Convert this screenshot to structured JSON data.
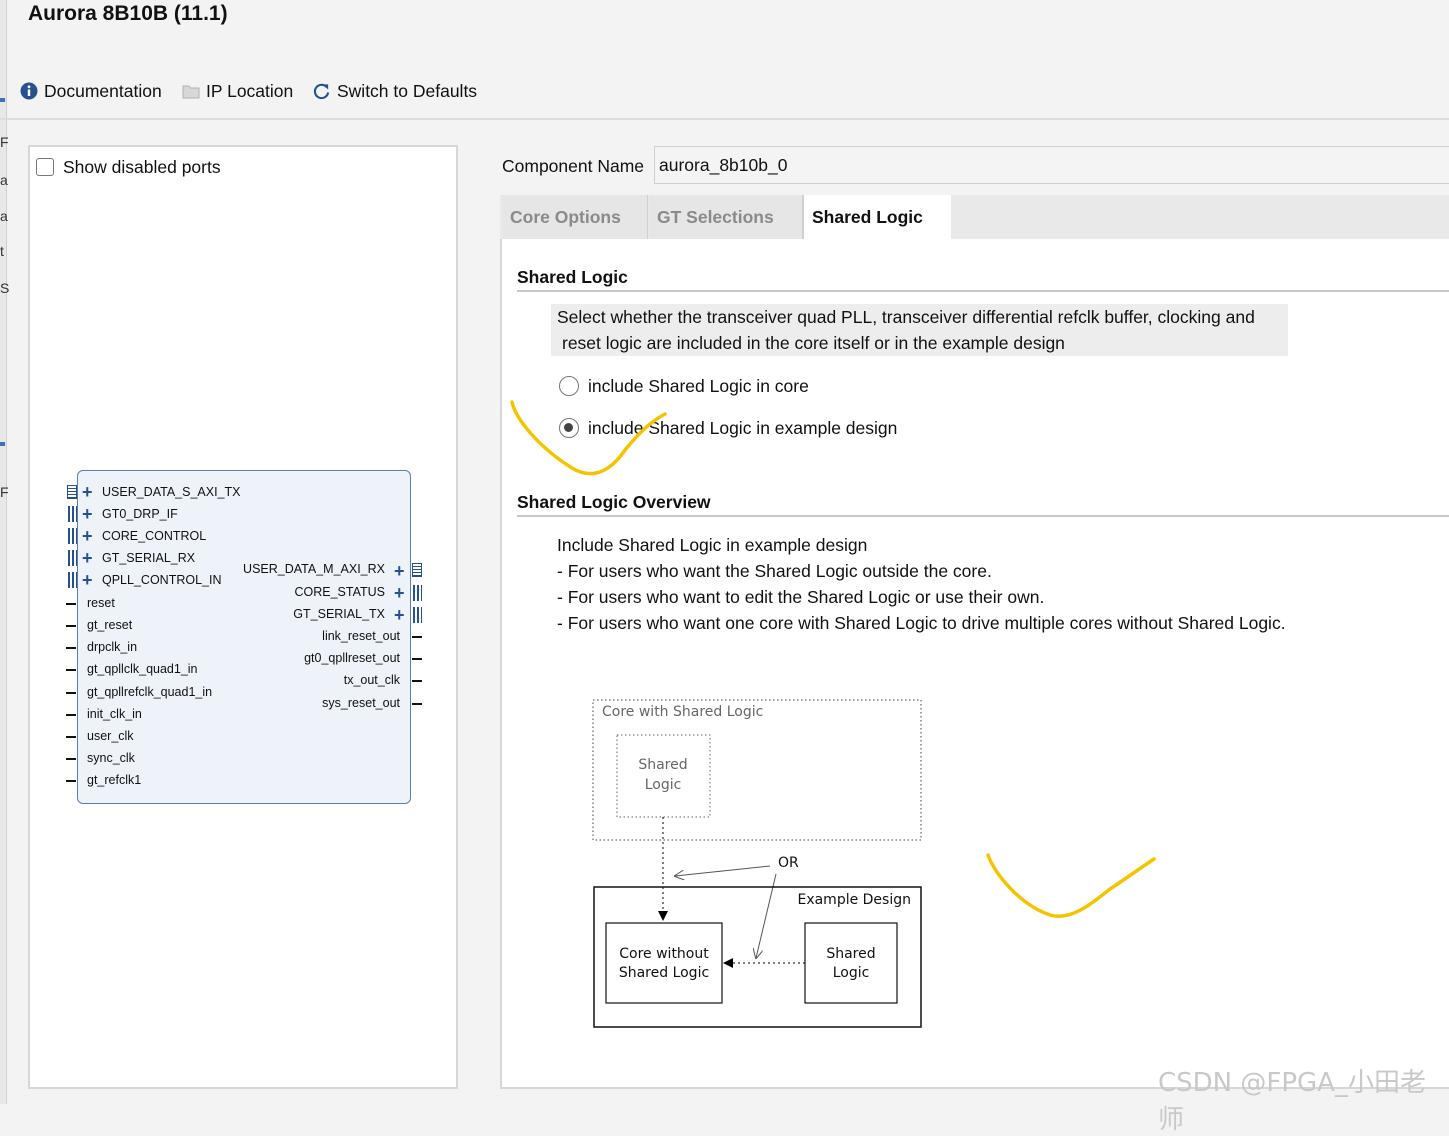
{
  "window": {
    "title": "Aurora 8B10B (11.1)"
  },
  "edge_chars": [
    "F",
    "a",
    "a",
    "t",
    "S",
    "F"
  ],
  "toolbar": {
    "documentation": "Documentation",
    "ip_location": "IP Location",
    "switch_defaults": "Switch to Defaults"
  },
  "left_panel": {
    "show_disabled_ports": "Show disabled ports",
    "ip_block": {
      "left_buses": [
        "USER_DATA_S_AXI_TX",
        "GT0_DRP_IF",
        "CORE_CONTROL",
        "GT_SERIAL_RX",
        "QPLL_CONTROL_IN"
      ],
      "left_ports": [
        "reset",
        "gt_reset",
        "drpclk_in",
        "gt_qpllclk_quad1_in",
        "gt_qpllrefclk_quad1_in",
        "init_clk_in",
        "user_clk",
        "sync_clk",
        "gt_refclk1"
      ],
      "right_buses": [
        "USER_DATA_M_AXI_RX",
        "CORE_STATUS",
        "GT_SERIAL_TX"
      ],
      "right_ports": [
        "link_reset_out",
        "gt0_qpllreset_out",
        "tx_out_clk",
        "sys_reset_out"
      ]
    }
  },
  "component": {
    "label": "Component Name",
    "value": "aurora_8b10b_0"
  },
  "tabs": [
    {
      "label": "Core Options",
      "active": false
    },
    {
      "label": "GT Selections",
      "active": false
    },
    {
      "label": "Shared Logic",
      "active": true
    }
  ],
  "shared_logic": {
    "title": "Shared Logic",
    "description_line1": "Select whether the transceiver quad PLL, transceiver differential refclk buffer, clocking and",
    "description_line2": "reset logic are included in the core itself or in the example design",
    "options": [
      {
        "label": "include Shared Logic in core",
        "selected": false
      },
      {
        "label": "include Shared Logic in example design",
        "selected": true
      }
    ]
  },
  "overview": {
    "title": "Shared Logic Overview",
    "lines": [
      "Include Shared Logic in example design",
      "- For users who want the Shared Logic outside the core.",
      "- For users who want to edit the Shared Logic or use their own.",
      "- For users who want one core with Shared Logic to drive multiple cores without Shared Logic."
    ]
  },
  "diagram": {
    "core_with_shared": "Core with Shared Logic",
    "shared_line1": "Shared",
    "shared_line2": "Logic",
    "or_label": "OR",
    "example_design": "Example Design",
    "core_without_line1": "Core without",
    "core_without_line2": "Shared Logic",
    "shared2_line1": "Shared",
    "shared2_line2": "Logic"
  },
  "annotation_color": "#f5c400",
  "accent_color": "#27508f",
  "watermark": "CSDN @FPGA_小田老师"
}
